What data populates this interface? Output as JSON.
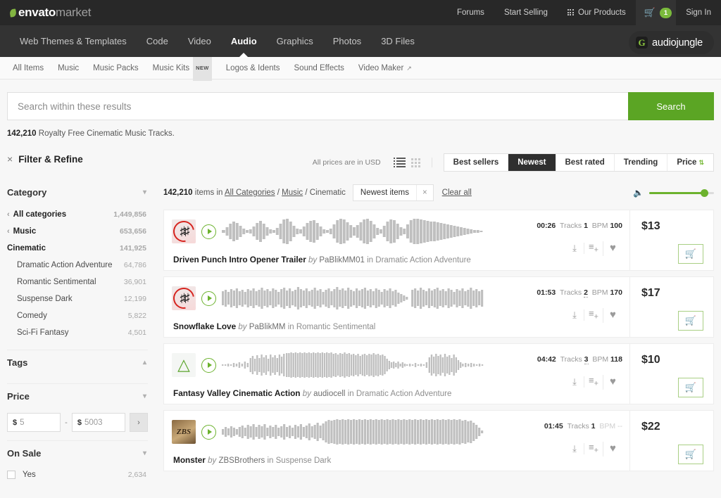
{
  "topbar": {
    "logo": {
      "brand": "envato",
      "suffix": "market"
    },
    "links": [
      {
        "label": "Forums"
      },
      {
        "label": "Start Selling"
      },
      {
        "label": "Our Products"
      }
    ],
    "cart_count": "1",
    "signin": "Sign In"
  },
  "mainnav": {
    "items": [
      {
        "label": "Web Themes & Templates",
        "active": false
      },
      {
        "label": "Code",
        "active": false
      },
      {
        "label": "Video",
        "active": false
      },
      {
        "label": "Audio",
        "active": true
      },
      {
        "label": "Graphics",
        "active": false
      },
      {
        "label": "Photos",
        "active": false
      },
      {
        "label": "3D Files",
        "active": false
      }
    ],
    "site_badge": "audiojungle",
    "site_badge_mark": "G"
  },
  "subnav": {
    "items": [
      {
        "label": "All Items",
        "badge": "",
        "external": false
      },
      {
        "label": "Music",
        "badge": "",
        "external": false
      },
      {
        "label": "Music Packs",
        "badge": "",
        "external": false
      },
      {
        "label": "Music Kits",
        "badge": "NEW",
        "external": false
      },
      {
        "label": "Logos & Idents",
        "badge": "",
        "external": false
      },
      {
        "label": "Sound Effects",
        "badge": "",
        "external": false
      },
      {
        "label": "Video Maker",
        "badge": "",
        "external": true
      }
    ]
  },
  "search": {
    "placeholder": "Search within these results",
    "value": "",
    "button_label": "Search"
  },
  "result_summary": {
    "count": "142,210",
    "text": " Royalty Free Cinematic Music Tracks."
  },
  "sidebar": {
    "filter_title": "Filter & Refine",
    "close_icon": "×",
    "facets": [
      {
        "title": "Category",
        "chevron": "⌄"
      },
      {
        "title": "Tags",
        "chevron": "⌃"
      },
      {
        "title": "Price",
        "chevron": "⌄"
      },
      {
        "title": "On Sale",
        "chevron": "⌄"
      }
    ],
    "categories": [
      {
        "label": "All categories",
        "count": "1,449,856",
        "level": 0
      },
      {
        "label": "Music",
        "count": "653,656",
        "level": 0
      },
      {
        "label": "Cinematic",
        "count": "141,925",
        "level": 1
      },
      {
        "label": "Dramatic Action Adventure",
        "count": "64,786",
        "level": 2
      },
      {
        "label": "Romantic Sentimental",
        "count": "36,901",
        "level": 2
      },
      {
        "label": "Suspense Dark",
        "count": "12,199",
        "level": 2
      },
      {
        "label": "Comedy",
        "count": "5,822",
        "level": 2
      },
      {
        "label": "Sci-Fi Fantasy",
        "count": "4,501",
        "level": 2
      }
    ],
    "price": {
      "currency": "$",
      "min_value": "5",
      "max_value": "5003",
      "separator": "-",
      "go_icon": "›"
    },
    "on_sale": {
      "label": "Yes",
      "count": "2,634",
      "checked": false
    }
  },
  "toolbar": {
    "usd_note": "All prices are in USD",
    "view_list": "list-view",
    "view_grid": "grid-view",
    "sorts": [
      {
        "label": "Best sellers",
        "active": false
      },
      {
        "label": "Newest",
        "active": true
      },
      {
        "label": "Best rated",
        "active": false
      },
      {
        "label": "Trending",
        "active": false
      },
      {
        "label": "Price",
        "active": false,
        "arrow": "⇅"
      }
    ]
  },
  "meta": {
    "count": "142,210",
    "items_in": " items in ",
    "breadcrumb": [
      {
        "label": "All Categories",
        "link": true
      },
      {
        "label": "Music",
        "link": true
      },
      {
        "label": "Cinematic",
        "link": false
      }
    ],
    "chip_label": "Newest items",
    "chip_close": "×",
    "clear_all": "Clear all",
    "volume_icon": "🔊",
    "volume_percent": 85
  },
  "results": [
    {
      "title": "Driven Punch Intro Opener Trailer",
      "by": "by",
      "author": "PaBlikMM01",
      "in": "in",
      "category": "Dramatic Action Adventure",
      "duration": "00:26",
      "tracks_label": "Tracks",
      "tracks": "1",
      "tracks_multi": false,
      "bpm_label": "BPM",
      "bpm": "100",
      "price": "$13",
      "thumb": "t-pablik",
      "wave": "spiky"
    },
    {
      "title": "Snowflake Love",
      "by": "by",
      "author": "PaBlikMM",
      "in": "in",
      "category": "Romantic Sentimental",
      "duration": "01:53",
      "tracks_label": "Tracks",
      "tracks": "2",
      "tracks_multi": true,
      "bpm_label": "BPM",
      "bpm": "170",
      "price": "$17",
      "thumb": "t-pablik",
      "wave": "dense"
    },
    {
      "title": "Fantasy Valley Cinematic Action",
      "by": "by",
      "author": "audiocell",
      "in": "in",
      "category": "Dramatic Action Adventure",
      "duration": "04:42",
      "tracks_label": "Tracks",
      "tracks": "3",
      "tracks_multi": true,
      "bpm_label": "BPM",
      "bpm": "118",
      "price": "$10",
      "thumb": "t-audiocell",
      "wave": "swell"
    },
    {
      "title": "Monster",
      "by": "by",
      "author": "ZBSBrothers",
      "in": "in",
      "category": "Suspense Dark",
      "duration": "01:45",
      "tracks_label": "Tracks",
      "tracks": "1",
      "tracks_multi": false,
      "bpm_label": "BPM",
      "bpm": "--",
      "bpm_dim": true,
      "price": "$22",
      "thumb": "t-zbs",
      "wave": "block"
    }
  ],
  "icons": {
    "download": "⤓",
    "addlist": "≡",
    "heart": "♥",
    "cart": "🛒"
  },
  "colors": {
    "accent_green": "#5ba524",
    "dark_nav": "#333333",
    "topbar": "#282828"
  }
}
